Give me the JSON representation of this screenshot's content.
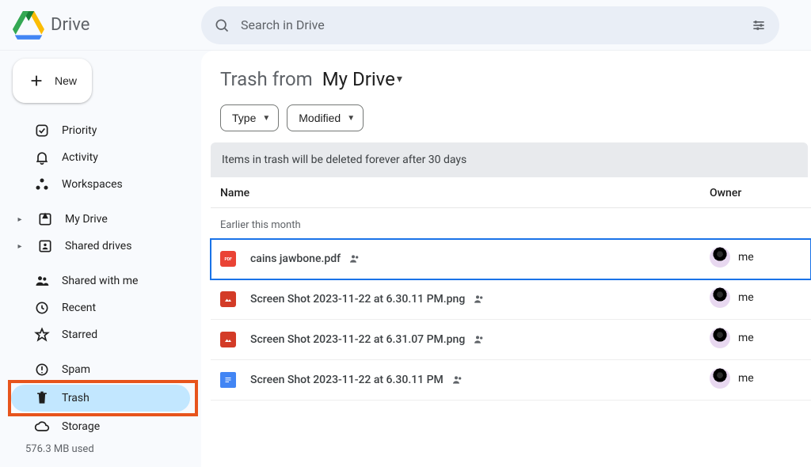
{
  "header": {
    "app_name": "Drive",
    "search_placeholder": "Search in Drive"
  },
  "sidebar": {
    "new_label": "New",
    "groups": [
      {
        "items": [
          {
            "icon": "priority",
            "label": "Priority"
          },
          {
            "icon": "activity",
            "label": "Activity"
          },
          {
            "icon": "workspaces",
            "label": "Workspaces"
          }
        ]
      },
      {
        "items": [
          {
            "icon": "mydrive",
            "label": "My Drive",
            "expandable": true
          },
          {
            "icon": "shareddrives",
            "label": "Shared drives",
            "expandable": true
          }
        ]
      },
      {
        "items": [
          {
            "icon": "sharedwithme",
            "label": "Shared with me"
          },
          {
            "icon": "recent",
            "label": "Recent"
          },
          {
            "icon": "starred",
            "label": "Starred"
          }
        ]
      },
      {
        "items": [
          {
            "icon": "spam",
            "label": "Spam"
          },
          {
            "icon": "trash",
            "label": "Trash",
            "active": true,
            "boxed": true
          },
          {
            "icon": "storage",
            "label": "Storage"
          }
        ]
      }
    ],
    "storage_used": "576.3 MB used"
  },
  "main": {
    "title_prefix": "Trash from",
    "title_scope": "My Drive",
    "chips": {
      "type": "Type",
      "modified": "Modified"
    },
    "banner": "Items in trash will be deleted forever after 30 days",
    "columns": {
      "name": "Name",
      "owner": "Owner"
    },
    "group_label": "Earlier this month",
    "owner_me": "me",
    "files": [
      {
        "kind": "pdf",
        "name": "cains jawbone.pdf",
        "shared": true,
        "selected": true
      },
      {
        "kind": "img",
        "name": "Screen Shot 2023-11-22 at 6.30.11 PM.png",
        "shared": true
      },
      {
        "kind": "img",
        "name": "Screen Shot 2023-11-22 at 6.31.07 PM.png",
        "shared": true
      },
      {
        "kind": "doc",
        "name": "Screen Shot 2023-11-22 at 6.30.11 PM",
        "shared": true
      }
    ]
  }
}
